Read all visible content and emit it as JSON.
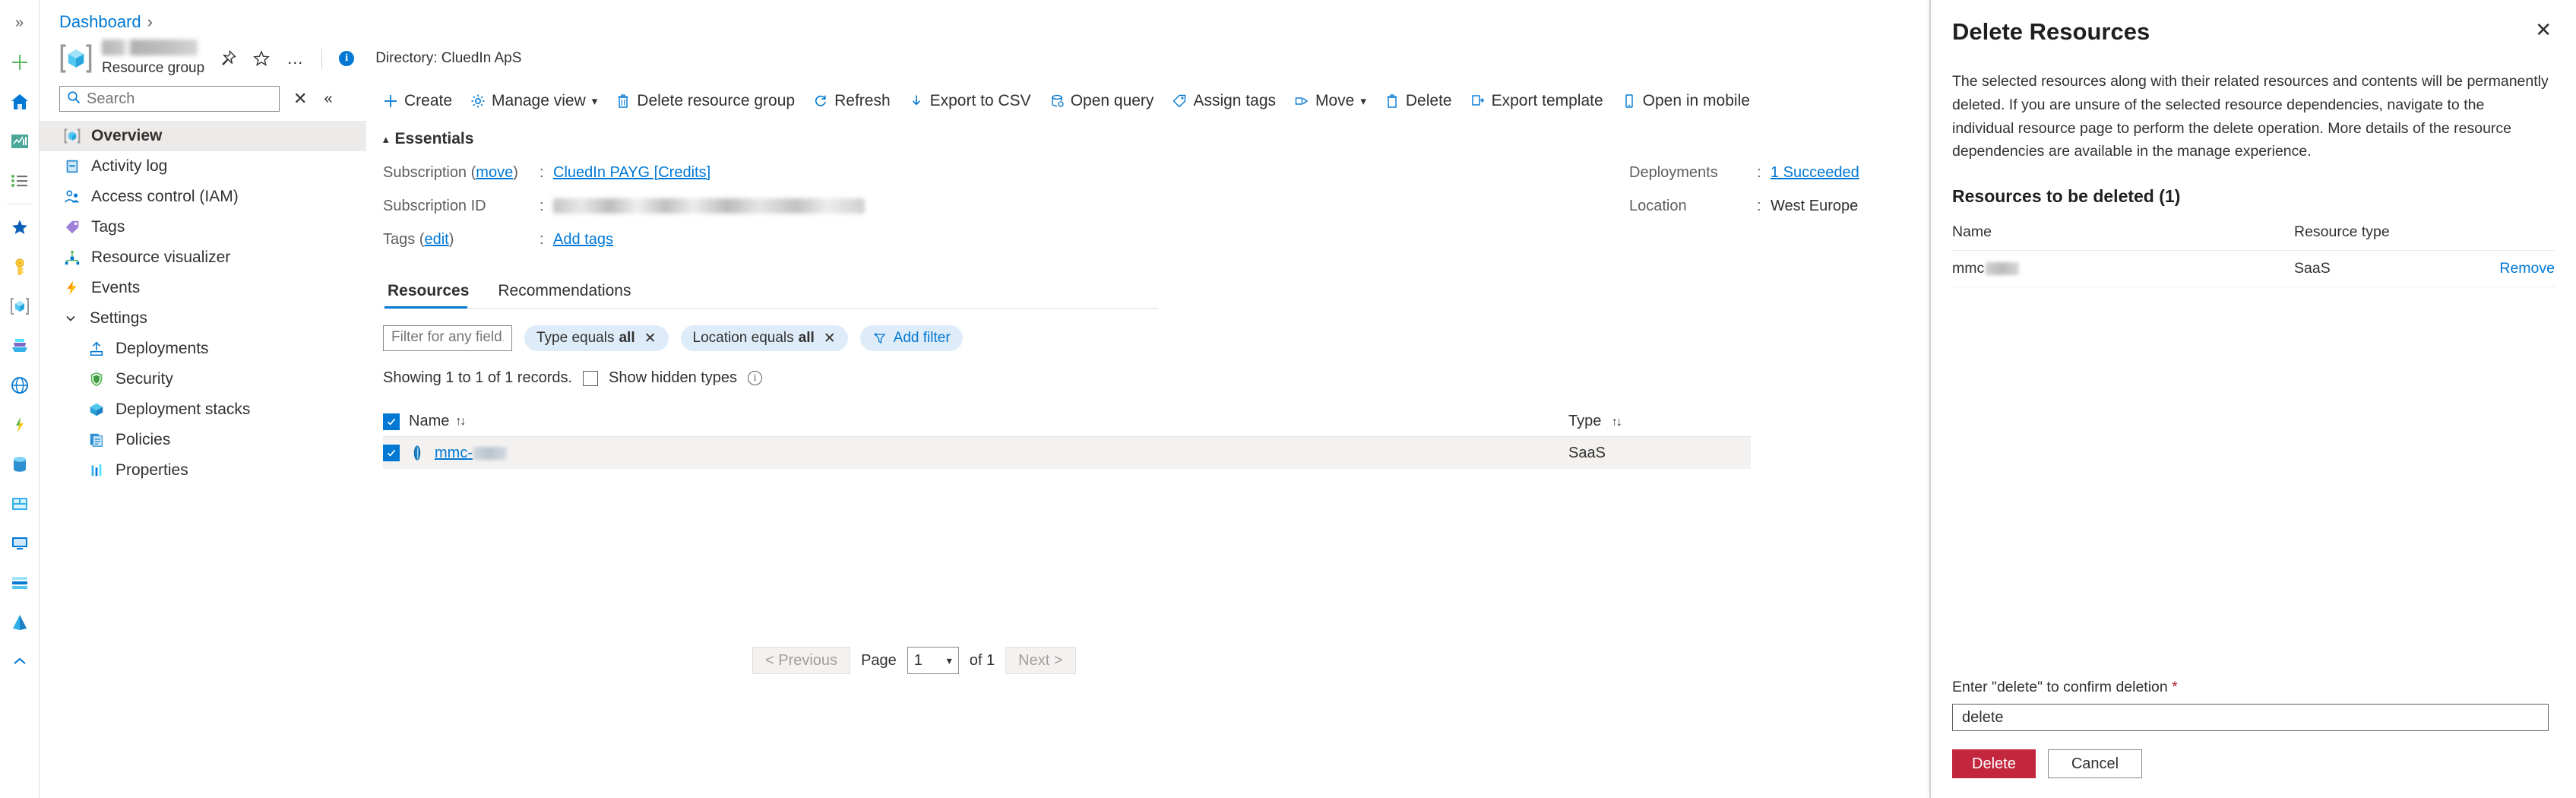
{
  "rail": {
    "collapse_label": "»",
    "items": [
      {
        "name": "create-resource",
        "icon": "plus-icon"
      },
      {
        "name": "home",
        "icon": "home-icon"
      },
      {
        "name": "dashboard",
        "icon": "dashboard-chart-icon"
      },
      {
        "name": "all-services",
        "icon": "list-icon"
      },
      {
        "name": "favorites",
        "icon": "star-icon"
      },
      {
        "name": "key-vaults",
        "icon": "key-icon"
      },
      {
        "name": "resource-groups",
        "icon": "resource-group-icon"
      },
      {
        "name": "storage-accounts",
        "icon": "storage-icon"
      },
      {
        "name": "app-services",
        "icon": "globe-icon"
      },
      {
        "name": "function-apps",
        "icon": "function-icon"
      },
      {
        "name": "sql-databases",
        "icon": "database-icon"
      },
      {
        "name": "azure-cosmos-db",
        "icon": "cosmos-icon"
      },
      {
        "name": "virtual-machines",
        "icon": "vm-icon"
      },
      {
        "name": "load-balancers",
        "icon": "load-balancer-icon"
      },
      {
        "name": "azure-active-directory",
        "icon": "aad-icon"
      },
      {
        "name": "more-services",
        "icon": "chevron-up-icon"
      }
    ]
  },
  "breadcrumb": {
    "root": "Dashboard",
    "separator": "›"
  },
  "resource": {
    "subtitle": "Resource group",
    "directory": "Directory: CluedIn ApS",
    "actions": {
      "pin": "pin-icon",
      "favorite": "star-icon",
      "more": "…"
    }
  },
  "search": {
    "placeholder": "Search",
    "value": ""
  },
  "menu": {
    "items": [
      {
        "label": "Overview",
        "icon": "resource-group-icon",
        "selected": true
      },
      {
        "label": "Activity log",
        "icon": "activity-log-icon",
        "selected": false
      },
      {
        "label": "Access control (IAM)",
        "icon": "access-control-icon",
        "selected": false
      },
      {
        "label": "Tags",
        "icon": "tag-icon",
        "selected": false
      },
      {
        "label": "Resource visualizer",
        "icon": "resource-visualizer-icon",
        "selected": false
      },
      {
        "label": "Events",
        "icon": "events-lightning-icon",
        "selected": false
      }
    ],
    "group_label": "Settings",
    "sub_items": [
      {
        "label": "Deployments",
        "icon": "deployments-icon"
      },
      {
        "label": "Security",
        "icon": "shield-icon"
      },
      {
        "label": "Deployment stacks",
        "icon": "deployment-stacks-icon"
      },
      {
        "label": "Policies",
        "icon": "policies-icon"
      },
      {
        "label": "Properties",
        "icon": "properties-icon"
      }
    ]
  },
  "toolbar": {
    "create": "Create",
    "manage_view": "Manage view",
    "delete_resource_group": "Delete resource group",
    "refresh": "Refresh",
    "export_csv": "Export to CSV",
    "open_query": "Open query",
    "assign_tags": "Assign tags",
    "move": "Move",
    "delete": "Delete",
    "export_template": "Export template",
    "open_in_mobile": "Open in mobile"
  },
  "essentials": {
    "title": "Essentials",
    "subscription_label": "Subscription",
    "subscription_move": "move",
    "subscription_value": "CluedIn PAYG [Credits]",
    "subscription_id_label": "Subscription ID",
    "tags_label": "Tags",
    "tags_edit": "edit",
    "tags_value": "Add tags",
    "deployments_label": "Deployments",
    "deployments_value": "1 Succeeded",
    "location_label": "Location",
    "location_value": "West Europe"
  },
  "tabs": [
    {
      "label": "Resources",
      "active": true
    },
    {
      "label": "Recommendations",
      "active": false
    }
  ],
  "filters": {
    "field_placeholder": "Filter for any field...",
    "field_value": "",
    "pills": [
      {
        "prefix": "Type equals",
        "value": "all"
      },
      {
        "prefix": "Location equals",
        "value": "all"
      }
    ],
    "add_filter": "Add filter"
  },
  "records": {
    "showing": "Showing 1 to 1 of 1 records.",
    "show_hidden_types": "Show hidden types",
    "show_hidden_checked": false
  },
  "table": {
    "columns": [
      {
        "key": "name",
        "label": "Name",
        "sort": "↑↓"
      },
      {
        "key": "type",
        "label": "Type",
        "sort": "↑↓"
      }
    ],
    "rows": [
      {
        "name": "mmc-",
        "type": "SaaS",
        "checked": true,
        "icon": "saas-resource-icon"
      }
    ]
  },
  "pager": {
    "previous": "< Previous",
    "page_label": "Page",
    "page_value": "1",
    "of_label": "of 1",
    "next": "Next >"
  },
  "panel": {
    "title": "Delete Resources",
    "close": "✕",
    "description": "The selected resources along with their related resources and contents will be permanently deleted. If you are unsure of the selected resource dependencies, navigate to the individual resource page to perform the delete operation. More details of the resource dependencies are available in the manage experience.",
    "section_title": "Resources to be deleted (1)",
    "columns": {
      "name": "Name",
      "resource_type": "Resource type"
    },
    "rows": [
      {
        "name": "mmc",
        "resource_type": "SaaS",
        "action": "Remove"
      }
    ],
    "confirm_label": "Enter \"delete\" to confirm deletion",
    "required_mark": "*",
    "confirm_value": "delete",
    "delete_button": "Delete",
    "cancel_button": "Cancel"
  },
  "colors": {
    "accent": "#0078d4",
    "danger": "#c2273d",
    "selected_row": "#f3f2f1",
    "pill": "#deecf9"
  }
}
